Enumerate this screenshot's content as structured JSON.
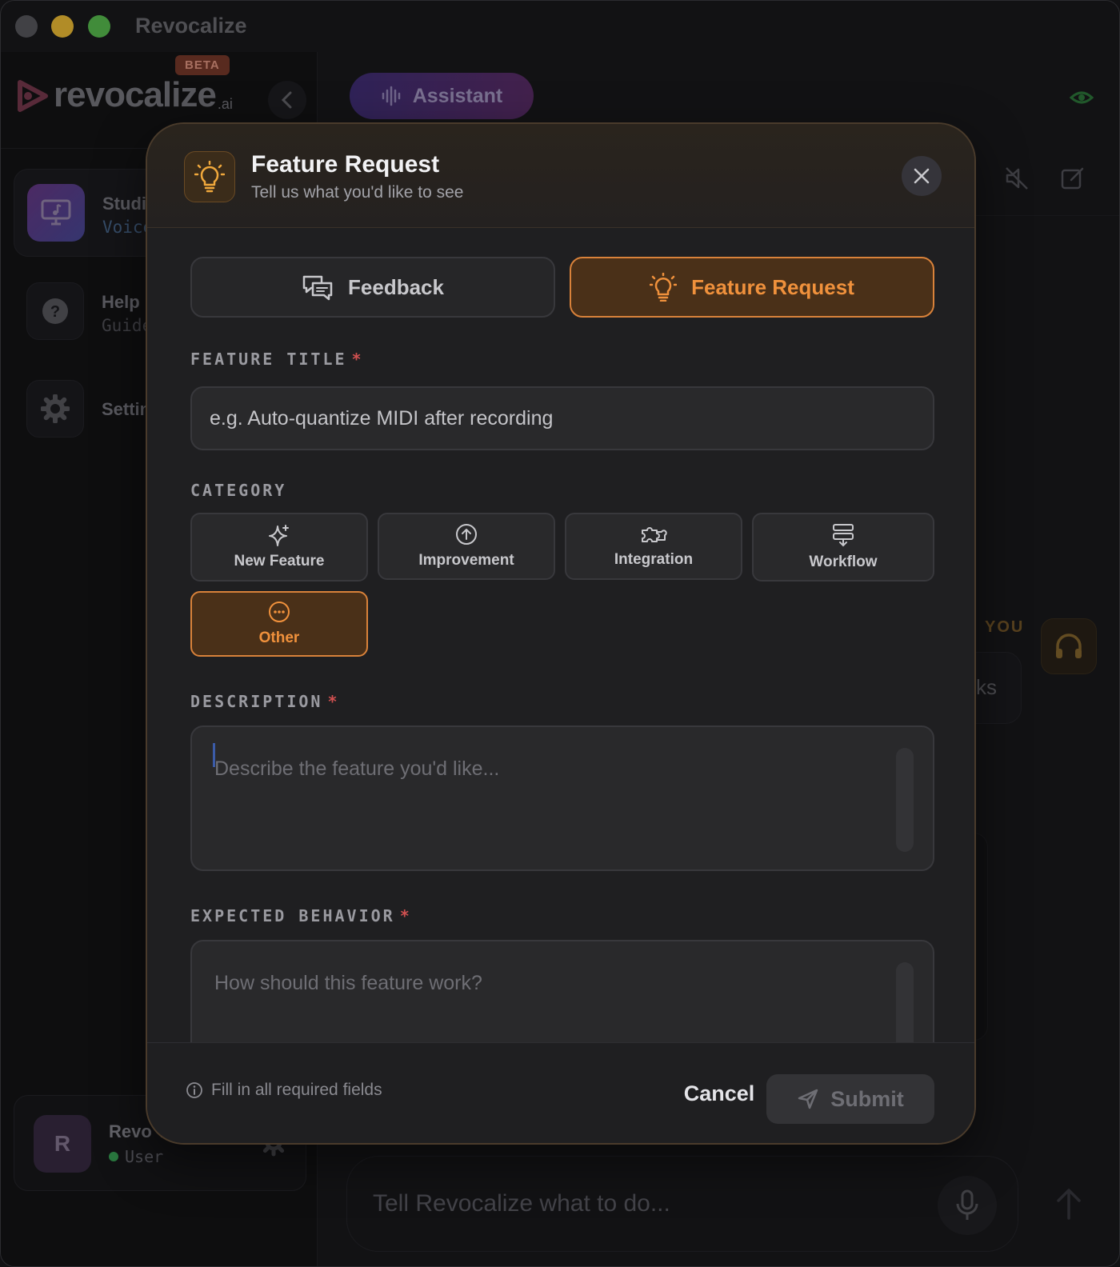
{
  "window": {
    "title": "Revocalize"
  },
  "sidebar": {
    "logo_text": "revocalize",
    "logo_suffix": ".ai",
    "beta_badge": "BETA",
    "items": [
      {
        "title": "Studio",
        "subtitle": "Voice",
        "icon": "monitor-music-icon"
      },
      {
        "title": "Help",
        "subtitle": "Guide",
        "icon": "question-icon"
      },
      {
        "title": "Settings",
        "subtitle": "",
        "icon": "gear-icon"
      }
    ],
    "user": {
      "initial": "R",
      "name": "Revo Test",
      "role": "User",
      "status_color": "#3aa657"
    }
  },
  "main": {
    "assistant_label": "Assistant",
    "you_label": "YOU",
    "bubble_text": "ks",
    "composer_placeholder": "Tell Revocalize what to do..."
  },
  "modal": {
    "title": "Feature Request",
    "subtitle": "Tell us what you'd like to see",
    "tabs": [
      {
        "label": "Feedback",
        "icon": "chat-bubbles-icon",
        "active": false
      },
      {
        "label": "Feature Request",
        "icon": "lightbulb-icon",
        "active": true
      }
    ],
    "feature_title": {
      "label": "FEATURE TITLE",
      "required_mark": "*",
      "value": "e.g. Auto-quantize MIDI after recording"
    },
    "category": {
      "label": "CATEGORY",
      "options": [
        {
          "label": "New Feature",
          "icon": "sparkle-icon"
        },
        {
          "label": "Improvement",
          "icon": "arrow-up-circle-icon"
        },
        {
          "label": "Integration",
          "icon": "puzzle-icon"
        },
        {
          "label": "Workflow",
          "icon": "workflow-icon"
        },
        {
          "label": "Other",
          "icon": "dots-circle-icon"
        }
      ],
      "selected": "Other"
    },
    "description": {
      "label": "DESCRIPTION",
      "required_mark": "*",
      "placeholder": "Describe the feature you'd like..."
    },
    "expected_behavior": {
      "label": "EXPECTED BEHAVIOR",
      "required_mark": "*",
      "placeholder": "How should this feature work?"
    },
    "footer": {
      "hint": "Fill in all required fields",
      "cancel_label": "Cancel",
      "submit_label": "Submit"
    }
  },
  "colors": {
    "accent": "#f0913c",
    "accent_border": "#d9823a",
    "required": "#d05050"
  }
}
